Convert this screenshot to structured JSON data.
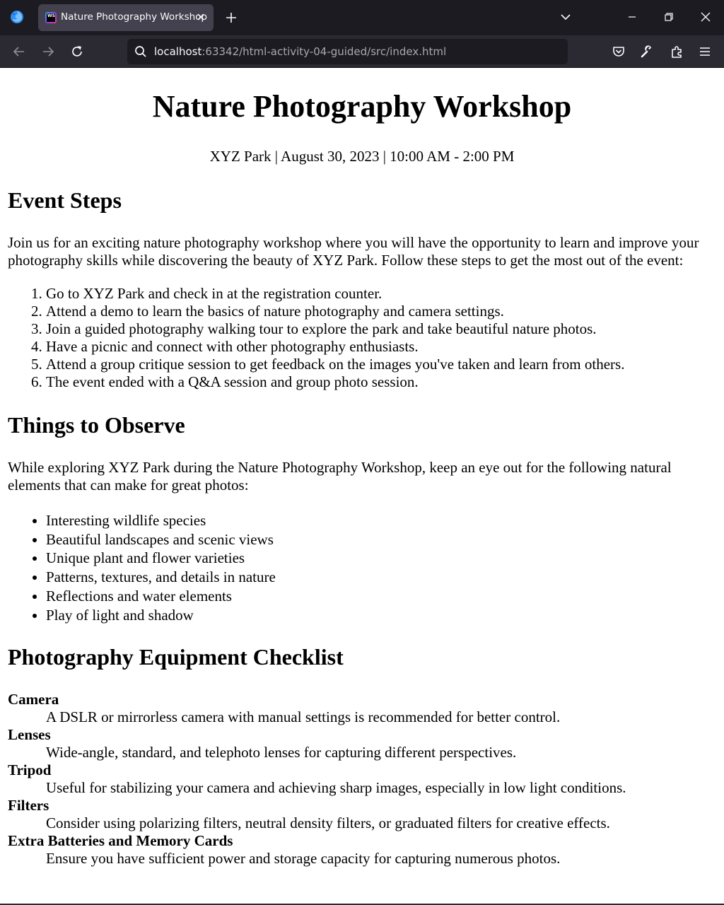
{
  "browser": {
    "tab_title": "Nature Photography Workshop",
    "favicon_text": "WS",
    "url_host": "localhost",
    "url_rest": ":63342/html-activity-04-guided/src/index.html"
  },
  "page": {
    "title": "Nature Photography Workshop",
    "subtitle": "XYZ Park | August 30, 2023 | 10:00 AM - 2:00 PM",
    "steps": {
      "heading": "Event Steps",
      "intro": "Join us for an exciting nature photography workshop where you will have the opportunity to learn and improve your photography skills while discovering the beauty of XYZ Park. Follow these steps to get the most out of the event:",
      "items": [
        "Go to XYZ Park and check in at the registration counter.",
        "Attend a demo to learn the basics of nature photography and camera settings.",
        "Join a guided photography walking tour to explore the park and take beautiful nature photos.",
        "Have a picnic and connect with other photography enthusiasts.",
        "Attend a group critique session to get feedback on the images you've taken and learn from others.",
        "The event ended with a Q&A session and group photo session."
      ]
    },
    "observe": {
      "heading": "Things to Observe",
      "intro": "While exploring XYZ Park during the Nature Photography Workshop, keep an eye out for the following natural elements that can make for great photos:",
      "items": [
        "Interesting wildlife species",
        "Beautiful landscapes and scenic views",
        "Unique plant and flower varieties",
        "Patterns, textures, and details in nature",
        "Reflections and water elements",
        "Play of light and shadow"
      ]
    },
    "equipment": {
      "heading": "Photography Equipment Checklist",
      "items": [
        {
          "term": "Camera",
          "desc": "A DSLR or mirrorless camera with manual settings is recommended for better control."
        },
        {
          "term": "Lenses",
          "desc": "Wide-angle, standard, and telephoto lenses for capturing different perspectives."
        },
        {
          "term": "Tripod",
          "desc": "Useful for stabilizing your camera and achieving sharp images, especially in low light conditions."
        },
        {
          "term": "Filters",
          "desc": "Consider using polarizing filters, neutral density filters, or graduated filters for creative effects."
        },
        {
          "term": "Extra Batteries and Memory Cards",
          "desc": "Ensure you have sufficient power and storage capacity for capturing numerous photos."
        }
      ]
    }
  },
  "colors": {
    "chrome_bg": "#1c1b22",
    "toolbar_bg": "#2b2a33",
    "tab_active_bg": "#42414d",
    "page_bg": "#ffffff",
    "text": "#000000"
  }
}
